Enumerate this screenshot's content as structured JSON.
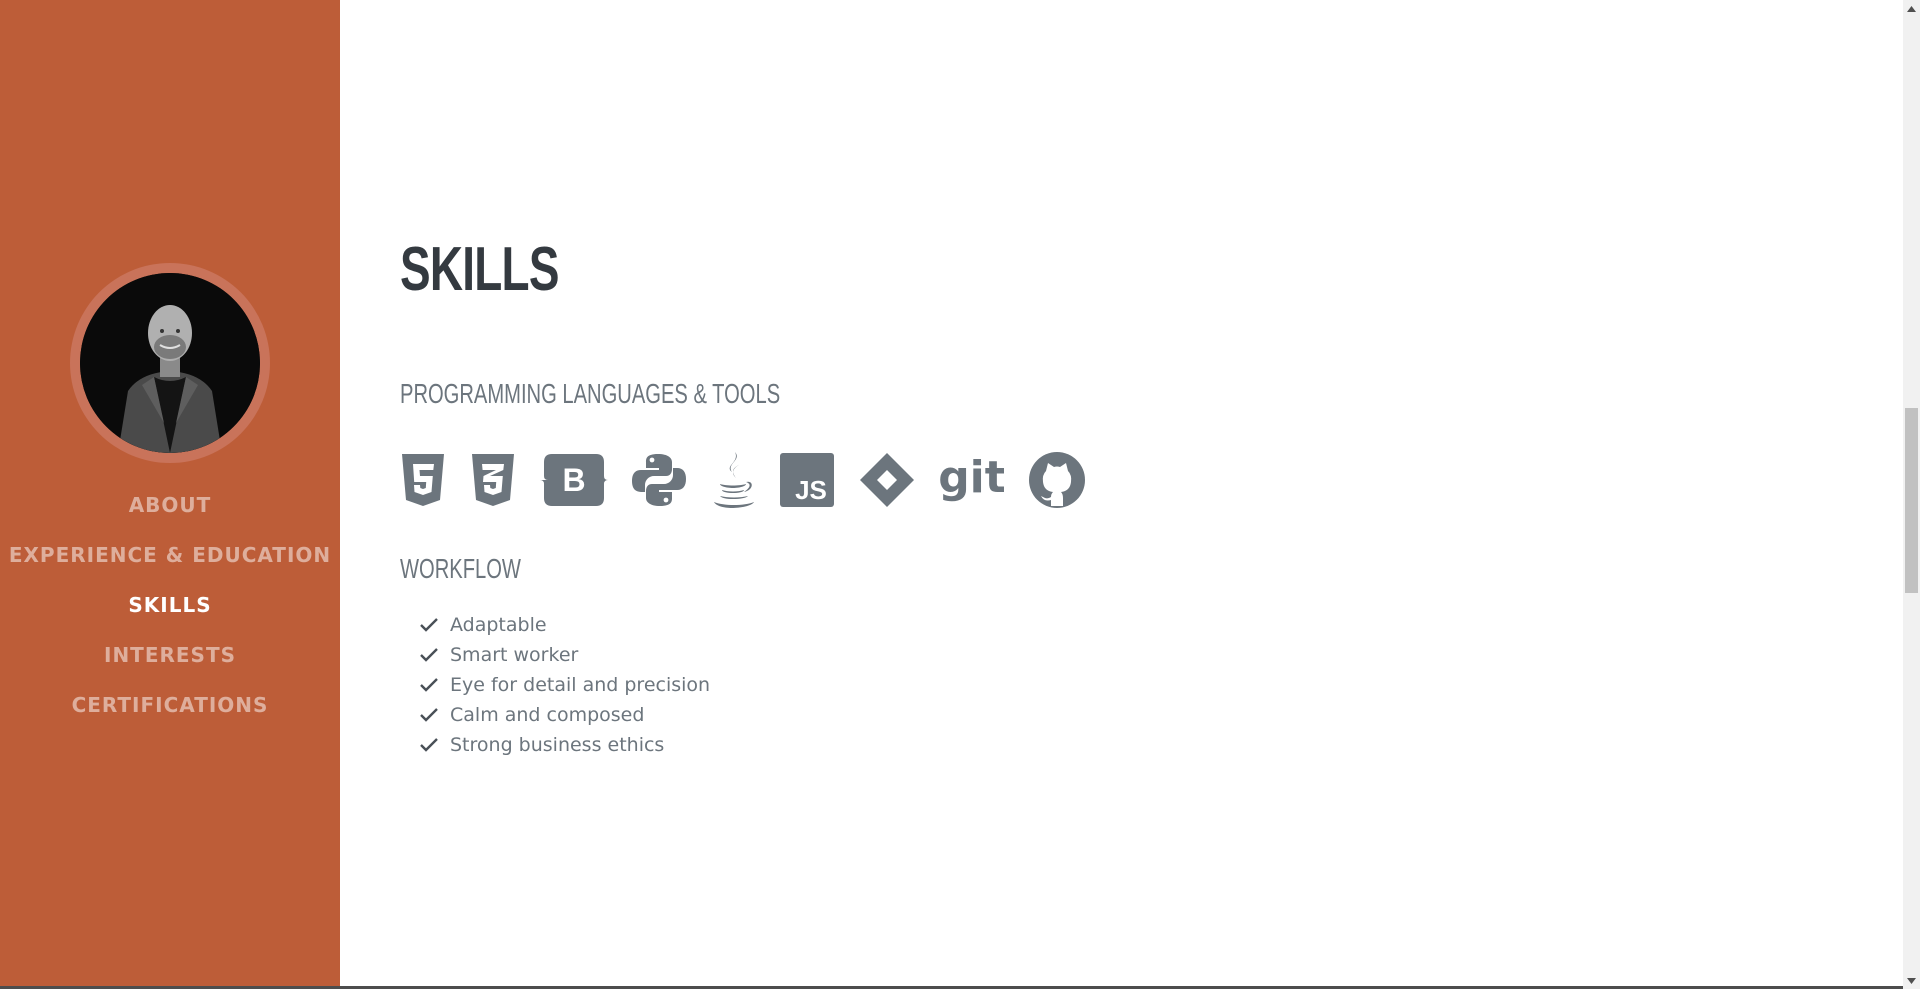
{
  "sidebar": {
    "background": "#bd5d38",
    "avatar_alt": "Profile photo",
    "nav": [
      {
        "label": "ABOUT",
        "active": false
      },
      {
        "label": "EXPERIENCE & EDUCATION",
        "active": false
      },
      {
        "label": "SKILLS",
        "active": true
      },
      {
        "label": "INTERESTS",
        "active": false
      },
      {
        "label": "CERTIFICATIONS",
        "active": false
      }
    ]
  },
  "main": {
    "title": "SKILLS",
    "tools_heading": "PROGRAMMING LANGUAGES & TOOLS",
    "tools": [
      "html5-icon",
      "css3-icon",
      "bootstrap-icon",
      "python-icon",
      "java-icon",
      "javascript-icon",
      "jira-icon",
      "git-icon",
      "github-icon"
    ],
    "git_text": "git",
    "js_text": "JS",
    "bootstrap_text": "B",
    "workflow_heading": "WORKFLOW",
    "workflow": [
      "Adaptable",
      "Smart worker",
      "Eye for detail and precision",
      "Calm and composed",
      "Strong business ethics"
    ]
  },
  "colors": {
    "heading": "#343a40",
    "muted": "#6c757d",
    "accent": "#bd5d38"
  }
}
